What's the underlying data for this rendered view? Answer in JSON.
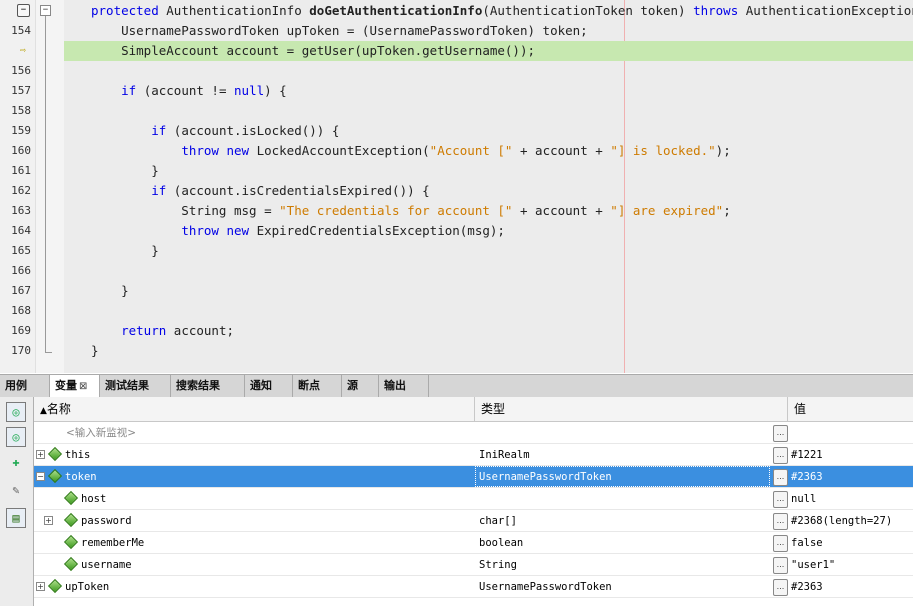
{
  "editor": {
    "lines": [
      {
        "num": "",
        "tokens": [
          [
            "kw",
            "protected "
          ],
          [
            "",
            "AuthenticationInfo "
          ],
          [
            "b",
            "doGetAuthenticationInfo"
          ],
          [
            "",
            "(AuthenticationToken token) "
          ],
          [
            "kw",
            "throws"
          ],
          [
            "",
            " AuthenticationException {"
          ]
        ]
      },
      {
        "num": "154",
        "tokens": [
          [
            "",
            "    UsernamePasswordToken upToken = (UsernamePasswordToken) token;"
          ]
        ]
      },
      {
        "num": "",
        "tokens": [
          [
            "",
            "    SimpleAccount account = getUser(upToken.getUsername());"
          ]
        ],
        "highlight": true
      },
      {
        "num": "156",
        "tokens": []
      },
      {
        "num": "157",
        "tokens": [
          [
            "",
            "    "
          ],
          [
            "kw",
            "if"
          ],
          [
            "",
            " (account != "
          ],
          [
            "kw",
            "null"
          ],
          [
            "",
            ") {"
          ]
        ]
      },
      {
        "num": "158",
        "tokens": []
      },
      {
        "num": "159",
        "tokens": [
          [
            "",
            "        "
          ],
          [
            "kw",
            "if"
          ],
          [
            "",
            " (account.isLocked()) {"
          ]
        ]
      },
      {
        "num": "160",
        "tokens": [
          [
            "",
            "            "
          ],
          [
            "kw",
            "throw new"
          ],
          [
            "",
            " LockedAccountException("
          ],
          [
            "str",
            "\"Account [\""
          ],
          [
            "",
            " + account + "
          ],
          [
            "str",
            "\"] is locked.\""
          ],
          [
            "",
            ");"
          ]
        ]
      },
      {
        "num": "161",
        "tokens": [
          [
            "",
            "        }"
          ]
        ]
      },
      {
        "num": "162",
        "tokens": [
          [
            "",
            "        "
          ],
          [
            "kw",
            "if"
          ],
          [
            "",
            " (account.isCredentialsExpired()) {"
          ]
        ]
      },
      {
        "num": "163",
        "tokens": [
          [
            "",
            "            String msg = "
          ],
          [
            "str",
            "\"The credentials for account [\""
          ],
          [
            "",
            " + account + "
          ],
          [
            "str",
            "\"] are expired\""
          ],
          [
            "",
            ";"
          ]
        ]
      },
      {
        "num": "164",
        "tokens": [
          [
            "",
            "            "
          ],
          [
            "kw",
            "throw new"
          ],
          [
            "",
            " ExpiredCredentialsException(msg);"
          ]
        ]
      },
      {
        "num": "165",
        "tokens": [
          [
            "",
            "        }"
          ]
        ]
      },
      {
        "num": "166",
        "tokens": []
      },
      {
        "num": "167",
        "tokens": [
          [
            "",
            "    }"
          ]
        ]
      },
      {
        "num": "168",
        "tokens": []
      },
      {
        "num": "169",
        "tokens": [
          [
            "",
            "    "
          ],
          [
            "kw",
            "return"
          ],
          [
            "",
            " account;"
          ]
        ]
      },
      {
        "num": "170",
        "tokens": [
          [
            "",
            "}"
          ]
        ]
      }
    ]
  },
  "tabs": [
    {
      "label": "用例",
      "active": false
    },
    {
      "label": "变量",
      "active": true,
      "close": "⊠"
    },
    {
      "label": "测试结果",
      "active": false
    },
    {
      "label": "搜索结果",
      "active": false
    },
    {
      "label": "通知",
      "active": false
    },
    {
      "label": "断点",
      "active": false
    },
    {
      "label": "源",
      "active": false
    },
    {
      "label": "输出",
      "active": false
    }
  ],
  "table": {
    "headers": {
      "name": "名称",
      "type": "类型",
      "value": "值"
    },
    "watch_placeholder": "<输入新监视>",
    "rows": [
      {
        "name": "this",
        "type": "IniRealm",
        "value": "#1221",
        "expand": "+",
        "level": 0
      },
      {
        "name": "token",
        "type": "UsernamePasswordToken",
        "value": "#2363",
        "expand": "−",
        "level": 0,
        "selected": true
      },
      {
        "name": "host",
        "type": "",
        "value": "null",
        "expand": "",
        "level": 1
      },
      {
        "name": "password",
        "type": "char[]",
        "value": "#2368(length=27)",
        "expand": "+",
        "level": 1
      },
      {
        "name": "rememberMe",
        "type": "boolean",
        "value": "false",
        "expand": "",
        "level": 1
      },
      {
        "name": "username",
        "type": "String",
        "value": "\"user1\"",
        "expand": "",
        "level": 1
      },
      {
        "name": "upToken",
        "type": "UsernamePasswordToken",
        "value": "#2363",
        "expand": "+",
        "level": 0
      }
    ],
    "edit_button": "..."
  },
  "toolbar": {
    "icons": [
      "watch-variables-icon",
      "watch-variables-icon",
      "add-watch-icon",
      "tools-icon",
      "document-icon"
    ]
  },
  "gutter": {
    "breakpoint_symbol": "−",
    "arrow_symbol": "⇨",
    "fold_symbol": "−"
  }
}
